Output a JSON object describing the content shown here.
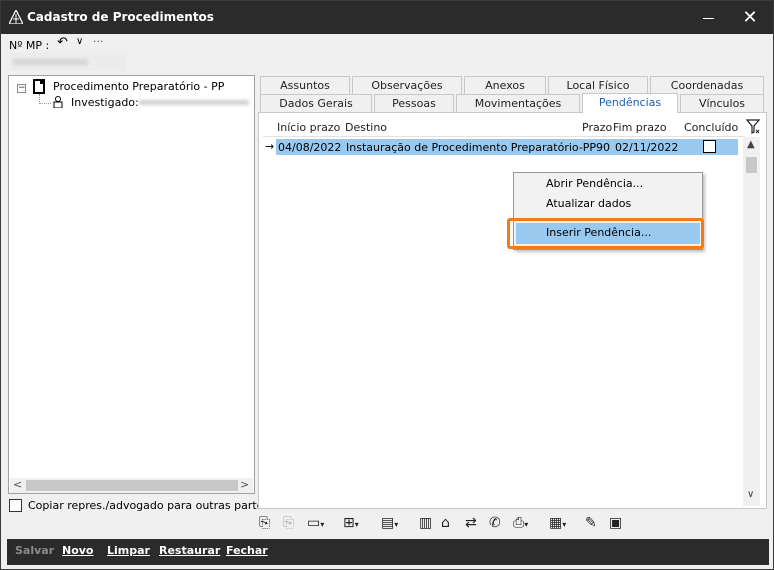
{
  "window": {
    "title": "Cadastro de Procedimentos",
    "minimize_icon": "minimize-icon",
    "close_icon": "close-icon"
  },
  "mp": {
    "label": "Nº MP :",
    "undo_icon": "undo-arrow-icon",
    "dropdown_icon": "chevron-down-icon",
    "more": "···"
  },
  "tree": {
    "root": "Procedimento Preparatório - PP",
    "child": "Investigado:",
    "expander": "−"
  },
  "copy_option": {
    "label": "Copiar repres./advogado para outras partes"
  },
  "tabs_row1": [
    "Assuntos",
    "Observações",
    "Anexos",
    "Local Físico",
    "Coordenadas"
  ],
  "tabs_row2": [
    "Dados Gerais",
    "Pessoas",
    "Movimentações",
    "Pendências",
    "Vínculos"
  ],
  "selected_tab": "Pendências",
  "grid": {
    "columns": [
      "Início prazo",
      "Destino",
      "Prazo",
      "Fim prazo",
      "Concluído"
    ],
    "rows": [
      {
        "inicio": "04/08/2022",
        "destino": "Instauração de Procedimento Preparatório-PP",
        "prazo": "90",
        "fim": "02/11/2022",
        "concluido": false
      }
    ],
    "row_indicator": "→"
  },
  "context_menu": {
    "items": [
      "Abrir Pendência...",
      "Atualizar dados",
      "Inserir Pendência..."
    ],
    "highlighted": "Inserir Pendência...",
    "highlight_color": "#ef7d17"
  },
  "bottom_buttons": [
    "Salvar",
    "Novo",
    "Limpar",
    "Restaurar",
    "Fechar"
  ],
  "colors": {
    "titlebar": "#2b2b2b",
    "selection": "#99c9ef",
    "tab_selected_text": "#1a5fb4",
    "accent": "#ef7d17"
  }
}
